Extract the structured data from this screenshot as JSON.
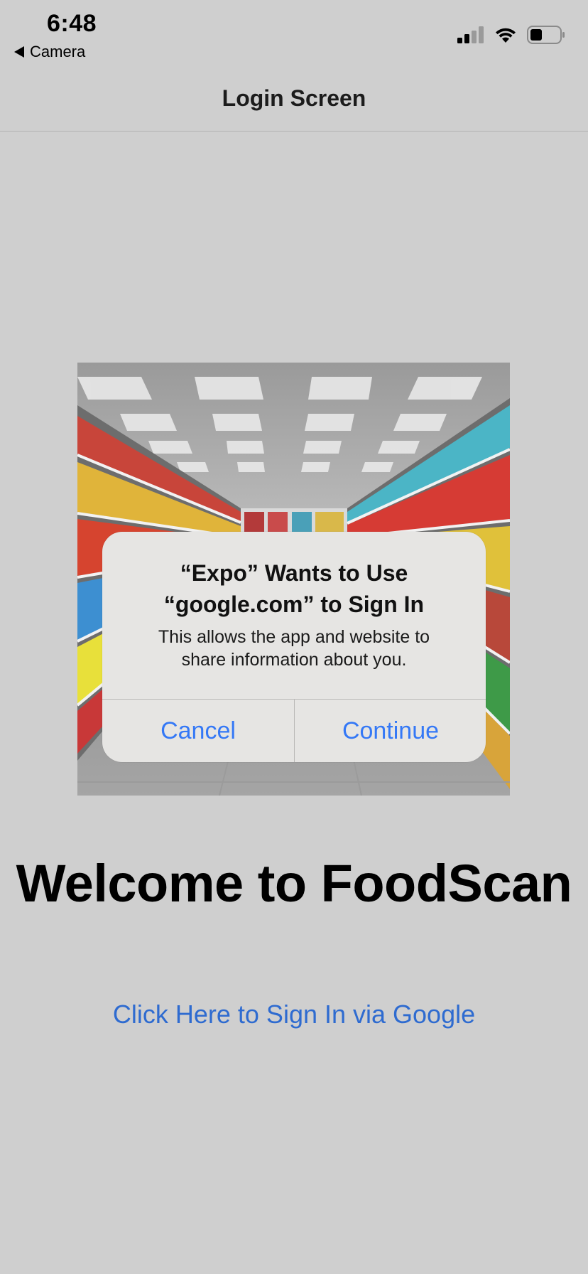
{
  "status_bar": {
    "time": "6:48",
    "back_app_label": "Camera"
  },
  "nav": {
    "title": "Login Screen"
  },
  "hero_image": {
    "description_icon": "supermarket-aisle-image"
  },
  "welcome": {
    "title": "Welcome to FoodScan"
  },
  "signin": {
    "link_label": "Click Here to Sign In via Google"
  },
  "alert": {
    "title_line1": "“Expo” Wants to Use",
    "title_line2": "“google.com” to Sign In",
    "message_line1": "This allows the app and website to",
    "message_line2": "share information about you.",
    "cancel_label": "Cancel",
    "continue_label": "Continue"
  },
  "colors": {
    "background": "#cfcfcf",
    "link": "#2e6bd0",
    "alert_button": "#3478f6",
    "alert_background": "#e6e5e3"
  }
}
